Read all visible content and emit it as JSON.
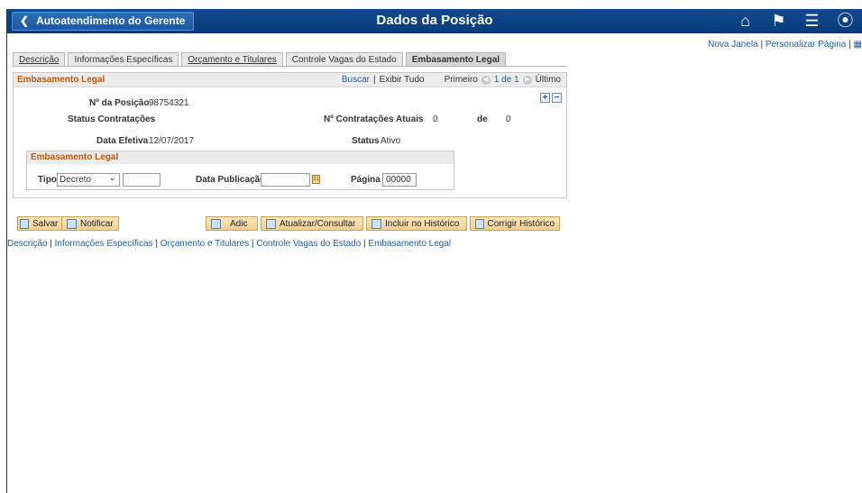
{
  "header": {
    "back_label": "Autoatendimento do Gerente",
    "title": "Dados da Posição",
    "icons": [
      "home-icon",
      "flag-icon",
      "menu-icon",
      "navbar-icon"
    ]
  },
  "utility": {
    "new_window": "Nova Janela",
    "personalize": "Personalizar Página"
  },
  "tabs": [
    {
      "label": "Descrição",
      "active": false
    },
    {
      "label": "Informações Específicas",
      "active": false
    },
    {
      "label": "Orçamento e Titulares",
      "active": false
    },
    {
      "label": "Controle Vagas do Estado",
      "active": false
    },
    {
      "label": "Embasamento Legal",
      "active": true
    }
  ],
  "section": {
    "title": "Embasamento Legal",
    "find": "Buscar",
    "view_all": "Exibir Tudo",
    "first": "Primeiro",
    "count": "1 de 1",
    "last": "Último",
    "add_symbol": "+",
    "remove_symbol": "−"
  },
  "fields": {
    "position_label": "Nº da Posição",
    "position_value": "98754321",
    "hiring_status_label": "Status Contratações",
    "current_hires_label": "Nº Contratações Atuais",
    "current_hires_value": "0",
    "of_label": "de",
    "of_value": "0",
    "effective_date_label": "Data Efetiva",
    "effective_date_value": "12/07/2017",
    "status_label": "Status",
    "status_value": "Ativo"
  },
  "legal": {
    "title": "Embasamento Legal",
    "type_label": "Tipo",
    "type_value": "Decreto",
    "number_value": "",
    "pub_date_label": "Data Publicação",
    "pub_date_value": "",
    "page_label": "Página",
    "page_value": "00000"
  },
  "toolbar": {
    "save": "Salvar",
    "notify": "Notificar",
    "add": "Adic",
    "update": "Atualizar/Consultar",
    "include_history": "Incluir no Histórico",
    "correct_history": "Corrigir Histórico"
  },
  "footer_links": [
    "Descrição",
    "Informações Específicas",
    "Orçamento e Titulares",
    "Controle Vagas do Estado",
    "Embasamento Legal"
  ]
}
